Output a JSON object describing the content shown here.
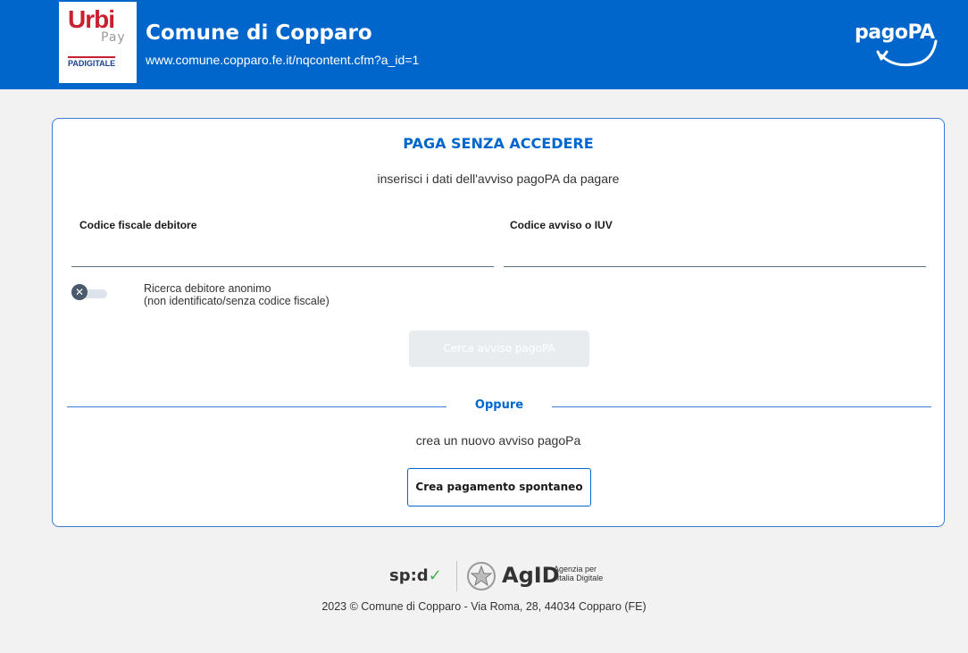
{
  "header": {
    "logo": {
      "urbi": "Urbi",
      "pay": "Pay",
      "padigitale": "PADIGITALE"
    },
    "title": "Comune di Copparo",
    "url": "www.comune.copparo.fe.it/nqcontent.cfm?a_id=1",
    "brand_logo": "pagoPA",
    "background_color": "#0066cc"
  },
  "form": {
    "title": "PAGA SENZA ACCEDERE",
    "subtitle": "inserisci i dati dell'avviso pagoPA da pagare",
    "codice_fiscale": {
      "label": "Codice fiscale debitore",
      "value": ""
    },
    "codice_avviso": {
      "label": "Codice avviso o IUV",
      "value": ""
    },
    "anonymous_toggle": {
      "line1": "Ricerca debitore anonimo",
      "line2": "(non identificato/senza codice fiscale)",
      "state": "off",
      "icon": "close-icon"
    },
    "search_button": "Cerca avviso pagoPA",
    "search_button_state": "disabled",
    "divider_label": "Oppure",
    "crea_text": "crea un nuovo avviso pagoPa",
    "crea_button": "Crea pagamento spontaneo"
  },
  "footer": {
    "spid_logo": "sp:d",
    "agid_logo": "AgID",
    "agid_sub1": "Agenzia per",
    "agid_sub2": "l'Italia Digitale",
    "copyright": "2023 © Comune di Copparo - Via Roma, 28, 44034 Copparo (FE)"
  },
  "colors": {
    "accent": "#0066cc",
    "card_border": "#3a7bd5",
    "page_background": "#f2f2f2"
  }
}
